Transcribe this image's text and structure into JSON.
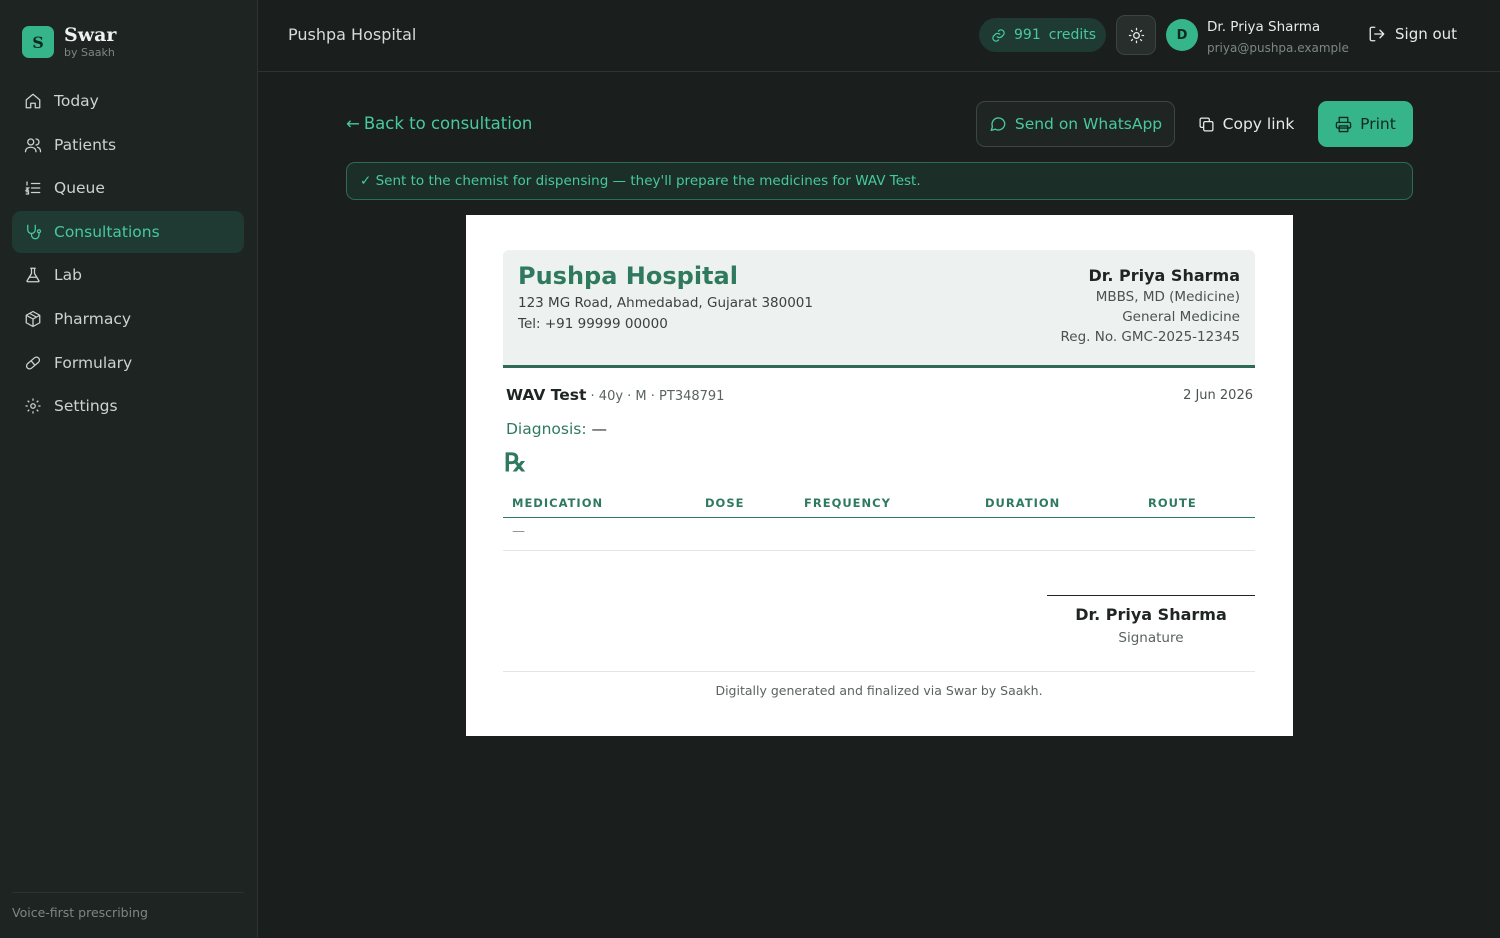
{
  "brand": {
    "initial": "S",
    "name": "Swar",
    "sub": "by Saakh"
  },
  "sidebar": {
    "items": [
      {
        "label": "Today",
        "icon": "home-icon",
        "active": false
      },
      {
        "label": "Patients",
        "icon": "users-icon",
        "active": false
      },
      {
        "label": "Queue",
        "icon": "list-ordered-icon",
        "active": false
      },
      {
        "label": "Consultations",
        "icon": "stethoscope-icon",
        "active": true
      },
      {
        "label": "Lab",
        "icon": "flask-icon",
        "active": false
      },
      {
        "label": "Pharmacy",
        "icon": "package-icon",
        "active": false
      },
      {
        "label": "Formulary",
        "icon": "pill-icon",
        "active": false
      },
      {
        "label": "Settings",
        "icon": "gear-icon",
        "active": false
      }
    ],
    "footer": "Voice-first prescribing"
  },
  "header": {
    "title": "Pushpa Hospital",
    "credits_value": "991",
    "credits_label": "credits",
    "avatar_initial": "D",
    "user_name": "Dr. Priya Sharma",
    "user_email": "priya@pushpa.example",
    "signout_label": "Sign out"
  },
  "actions": {
    "back_label": "Back to consultation",
    "whatsapp_label": "Send on WhatsApp",
    "copy_label": "Copy link",
    "print_label": "Print"
  },
  "notice": "✓ Sent to the chemist for dispensing — they'll prepare the medicines for WAV Test.",
  "prescription": {
    "hospital_name": "Pushpa Hospital",
    "hospital_address": "123 MG Road, Ahmedabad, Gujarat 380001",
    "hospital_tel": "Tel: +91 99999 00000",
    "doctor_name": "Dr. Priya Sharma",
    "doctor_degree": "MBBS, MD (Medicine)",
    "doctor_specialty": "General Medicine",
    "doctor_reg": "Reg. No. GMC-2025-12345",
    "patient_name": "WAV Test",
    "patient_meta": " · 40y · M · PT348791",
    "date": "2 Jun 2026",
    "diagnosis_label": "Diagnosis:",
    "diagnosis_value": "—",
    "rx_symbol": "℞",
    "columns": [
      "MEDICATION",
      "DOSE",
      "FREQUENCY",
      "DURATION",
      "ROUTE"
    ],
    "empty_row": "—",
    "signature_name": "Dr. Priya Sharma",
    "signature_label": "Signature",
    "footer": "Digitally generated and finalized via Swar by Saakh."
  },
  "colors": {
    "accent": "#36b58a",
    "accent_text": "#47c99c",
    "background": "#1a1f1e",
    "paper": "#ffffff"
  }
}
